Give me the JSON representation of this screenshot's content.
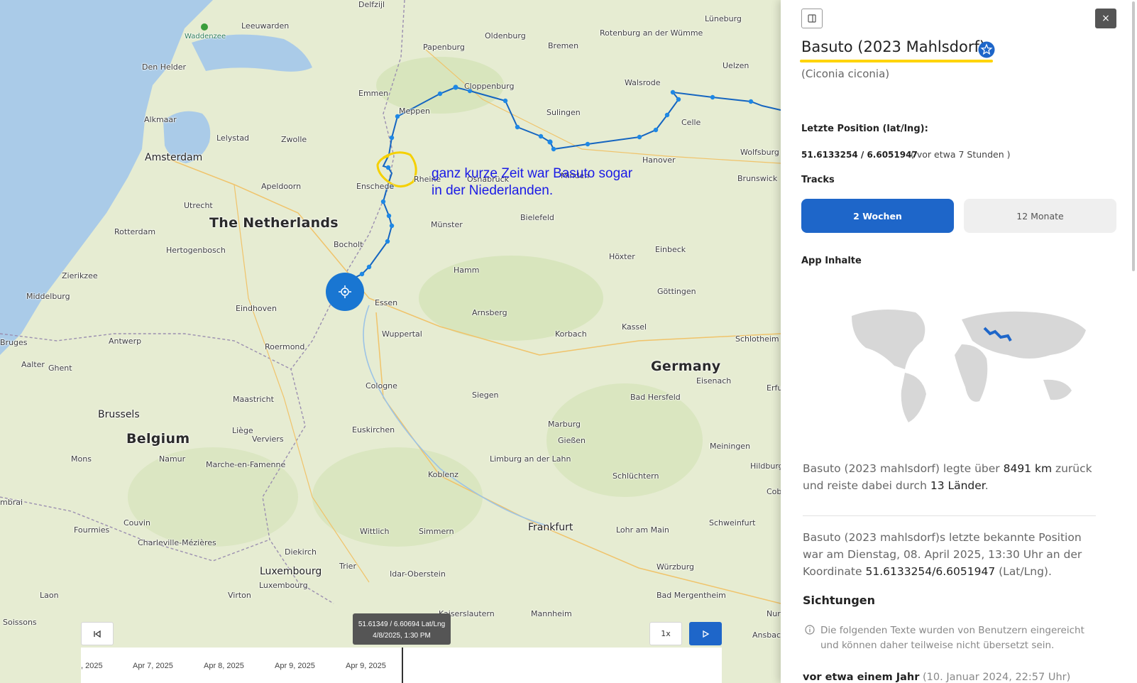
{
  "map": {
    "places": [
      {
        "name": "Delfzijl",
        "cls": ""
      },
      {
        "name": "Leeuwarden",
        "cls": ""
      },
      {
        "name": "Waddenzee",
        "cls": "water"
      },
      {
        "name": "Den Helder",
        "cls": ""
      },
      {
        "name": "Alkmaar",
        "cls": ""
      },
      {
        "name": "Lelystad",
        "cls": ""
      },
      {
        "name": "Zwolle",
        "cls": ""
      },
      {
        "name": "Emmen",
        "cls": ""
      },
      {
        "name": "Meppen",
        "cls": ""
      },
      {
        "name": "Papenburg",
        "cls": ""
      },
      {
        "name": "Oldenburg",
        "cls": ""
      },
      {
        "name": "Bremen",
        "cls": ""
      },
      {
        "name": "Rotenburg an der Wümme",
        "cls": ""
      },
      {
        "name": "Lüneburg",
        "cls": ""
      },
      {
        "name": "Uelzen",
        "cls": ""
      },
      {
        "name": "Walsrode",
        "cls": ""
      },
      {
        "name": "Cloppenburg",
        "cls": ""
      },
      {
        "name": "Sulingen",
        "cls": ""
      },
      {
        "name": "Celle",
        "cls": ""
      },
      {
        "name": "Wolfsburg",
        "cls": ""
      },
      {
        "name": "Amsterdam",
        "cls": "city"
      },
      {
        "name": "Apeldoorn",
        "cls": ""
      },
      {
        "name": "Enschede",
        "cls": ""
      },
      {
        "name": "Rheine",
        "cls": ""
      },
      {
        "name": "Osnabrück",
        "cls": ""
      },
      {
        "name": "Minden",
        "cls": ""
      },
      {
        "name": "Hanover",
        "cls": ""
      },
      {
        "name": "Brunswick",
        "cls": ""
      },
      {
        "name": "Utrecht",
        "cls": ""
      },
      {
        "name": "The Netherlands",
        "cls": "country"
      },
      {
        "name": "Rotterdam",
        "cls": ""
      },
      {
        "name": "Bocholt",
        "cls": ""
      },
      {
        "name": "Münster",
        "cls": ""
      },
      {
        "name": "Bielefeld",
        "cls": ""
      },
      {
        "name": "Höxter",
        "cls": ""
      },
      {
        "name": "Einbeck",
        "cls": ""
      },
      {
        "name": "Hertogenbosch",
        "cls": ""
      },
      {
        "name": "Zierikzee",
        "cls": ""
      },
      {
        "name": "Middelburg",
        "cls": ""
      },
      {
        "name": "Hamm",
        "cls": ""
      },
      {
        "name": "Göttingen",
        "cls": ""
      },
      {
        "name": "Eindhoven",
        "cls": ""
      },
      {
        "name": "Essen",
        "cls": ""
      },
      {
        "name": "Arnsberg",
        "cls": ""
      },
      {
        "name": "Bruges",
        "cls": ""
      },
      {
        "name": "Antwerp",
        "cls": ""
      },
      {
        "name": "Wuppertal",
        "cls": ""
      },
      {
        "name": "Korbach",
        "cls": ""
      },
      {
        "name": "Kassel",
        "cls": ""
      },
      {
        "name": "Schlotheim",
        "cls": ""
      },
      {
        "name": "Aalter",
        "cls": ""
      },
      {
        "name": "Ghent",
        "cls": ""
      },
      {
        "name": "Roermond",
        "cls": ""
      },
      {
        "name": "Germany",
        "cls": "country"
      },
      {
        "name": "Eisenach",
        "cls": ""
      },
      {
        "name": "Cologne",
        "cls": ""
      },
      {
        "name": "Maastricht",
        "cls": ""
      },
      {
        "name": "Siegen",
        "cls": ""
      },
      {
        "name": "Bad Hersfeld",
        "cls": ""
      },
      {
        "name": "Brussels",
        "cls": "city"
      },
      {
        "name": "Belgium",
        "cls": "country"
      },
      {
        "name": "Euskirchen",
        "cls": ""
      },
      {
        "name": "Marburg",
        "cls": ""
      },
      {
        "name": "Liège",
        "cls": ""
      },
      {
        "name": "Verviers",
        "cls": ""
      },
      {
        "name": "Gießen",
        "cls": ""
      },
      {
        "name": "Meiningen",
        "cls": ""
      },
      {
        "name": "Mons",
        "cls": ""
      },
      {
        "name": "Namur",
        "cls": ""
      },
      {
        "name": "Limburg an der Lahn",
        "cls": ""
      },
      {
        "name": "Koblenz",
        "cls": ""
      },
      {
        "name": "Schlüchtern",
        "cls": ""
      },
      {
        "name": "Marche-en-Famenne",
        "cls": ""
      },
      {
        "name": "Fourmies",
        "cls": ""
      },
      {
        "name": "Couvin",
        "cls": ""
      },
      {
        "name": "Wittlich",
        "cls": ""
      },
      {
        "name": "Simmern",
        "cls": ""
      },
      {
        "name": "Frankfurt",
        "cls": "city"
      },
      {
        "name": "Lohr am Main",
        "cls": ""
      },
      {
        "name": "Schweinfurt",
        "cls": ""
      },
      {
        "name": "Charleville-Mézières",
        "cls": ""
      },
      {
        "name": "Diekirch",
        "cls": ""
      },
      {
        "name": "Luxembourg",
        "cls": "city"
      },
      {
        "name": "Trier",
        "cls": ""
      },
      {
        "name": "Idar-Oberstein",
        "cls": ""
      },
      {
        "name": "Würzburg",
        "cls": ""
      },
      {
        "name": "Laon",
        "cls": ""
      },
      {
        "name": "Virton",
        "cls": ""
      },
      {
        "name": "Luxembourg",
        "cls": ""
      },
      {
        "name": "Kaiserslautern",
        "cls": ""
      },
      {
        "name": "Mannheim",
        "cls": ""
      },
      {
        "name": "Bad Mergentheim",
        "cls": ""
      },
      {
        "name": "Soissons",
        "cls": ""
      },
      {
        "name": "Ansbach",
        "cls": ""
      },
      {
        "name": "Nur",
        "cls": ""
      },
      {
        "name": "Coburg",
        "cls": ""
      },
      {
        "name": "Hildburghausen",
        "cls": ""
      },
      {
        "name": "Erfurt",
        "cls": ""
      },
      {
        "name": "mbrai",
        "cls": ""
      }
    ],
    "annotation_lines": [
      "ganz kurze Zeit war Basuto sogar",
      "in der Niederlanden."
    ],
    "route_color": "#1565c0",
    "highlight_color": "#f5d000"
  },
  "playback": {
    "speed_label": "1x",
    "tooltip_coords": "51.61349 / 6.60694 Lat/Lng",
    "tooltip_time": "4/8/2025, 1:30 PM",
    "ticks": [
      ", 2025",
      "Apr 7, 2025",
      "Apr 8, 2025",
      "Apr 9, 2025",
      "Apr 9, 2025"
    ]
  },
  "panel": {
    "name": "Basuto (2023 Mahlsdorf)",
    "latin": "(Ciconia ciconia)",
    "last_position_label": "Letzte Position (lat/lng):",
    "coords": "51.6133254 / 6.6051947",
    "ago": "( vor etwa 7 Stunden )",
    "tracks_label": "Tracks",
    "tab_2w": "2 Wochen",
    "tab_12m": "12 Monate",
    "app_label": "App Inhalte",
    "para1_pre": "Basuto (2023 mahlsdorf) legte über ",
    "para1_km": "8491 km",
    "para1_mid": " zurück und reiste dabei durch ",
    "para1_countries": "13 Länder",
    "para1_end": ".",
    "para2_pre": "Basuto (2023 mahlsdorf)s letzte bekannte Position war am Dienstag, 08. April 2025, 13:30 Uhr an der Koordinate ",
    "para2_coords": "51.6133254/6.6051947",
    "para2_end": " (Lat/Lng).",
    "sightings_label": "Sichtungen",
    "note": "Die folgenden Texte wurden von Benutzern eingereicht und können daher teilweise nicht übersetzt sein.",
    "entry_bold": "vor etwa einem Jahr",
    "entry_date": "(10. Januar 2024, 22:57 Uhr)",
    "accent_color": "#1e66c9"
  }
}
